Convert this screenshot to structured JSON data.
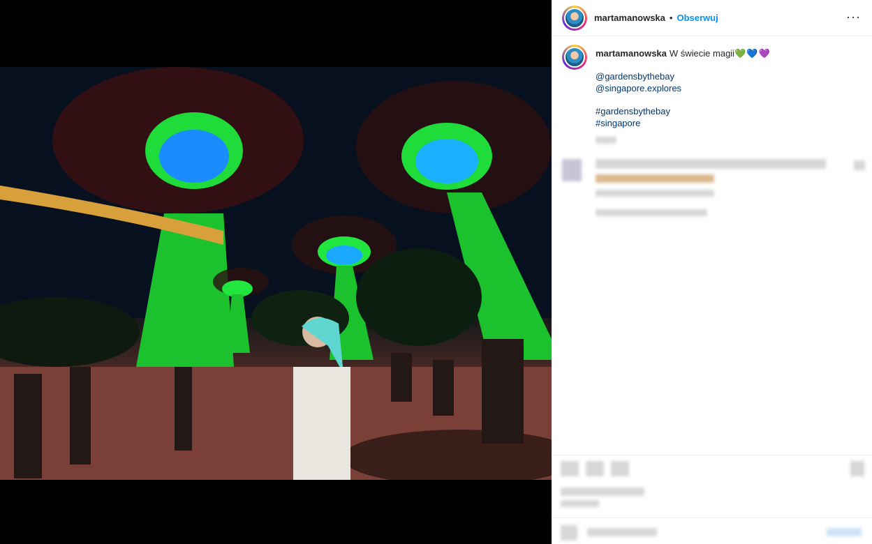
{
  "header": {
    "username": "martamanowska",
    "separator": "•",
    "follow_label": "Obserwuj",
    "more_label": "···"
  },
  "caption": {
    "username": "martamanowska",
    "text": "W świecie magii",
    "hearts": "💚💙💜",
    "mentions": [
      "@gardensbythebay",
      "@singapore.explores"
    ],
    "hashtags": [
      "#gardensbythebay",
      "#singapore"
    ]
  },
  "colors": {
    "link": "#00376b",
    "follow": "#0095f6",
    "text": "#262626",
    "border": "#efefef"
  },
  "icons": {
    "more": "more-options-icon",
    "like": "heart-icon",
    "comment": "comment-icon",
    "share": "share-icon",
    "save": "bookmark-icon",
    "emoji": "emoji-icon"
  }
}
